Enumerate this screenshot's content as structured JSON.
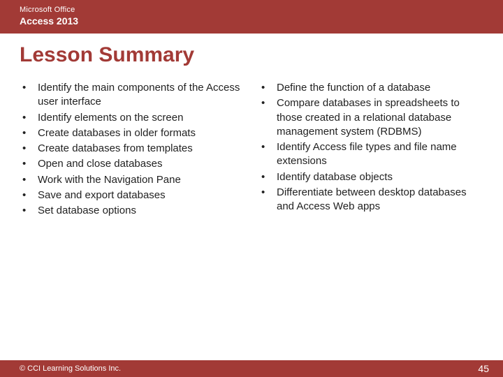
{
  "header": {
    "line1": "Microsoft Office",
    "line2": "Access 2013"
  },
  "title": "Lesson Summary",
  "columns": {
    "left": [
      "Identify the main components of the Access user interface",
      "Identify elements on the screen",
      "Create databases in older formats",
      "Create databases from templates",
      "Open and close databases",
      "Work with the Navigation Pane",
      "Save and export databases",
      "Set database options"
    ],
    "right": [
      "Define the function of a database",
      "Compare databases in spreadsheets to those created in a relational database management system (RDBMS)",
      "Identify Access file types and file name extensions",
      "Identify database objects",
      "Differentiate between desktop databases and Access Web apps"
    ]
  },
  "footer": {
    "copyright": "© CCI Learning Solutions Inc.",
    "page": "45"
  },
  "colors": {
    "brand": "#a23a36"
  }
}
